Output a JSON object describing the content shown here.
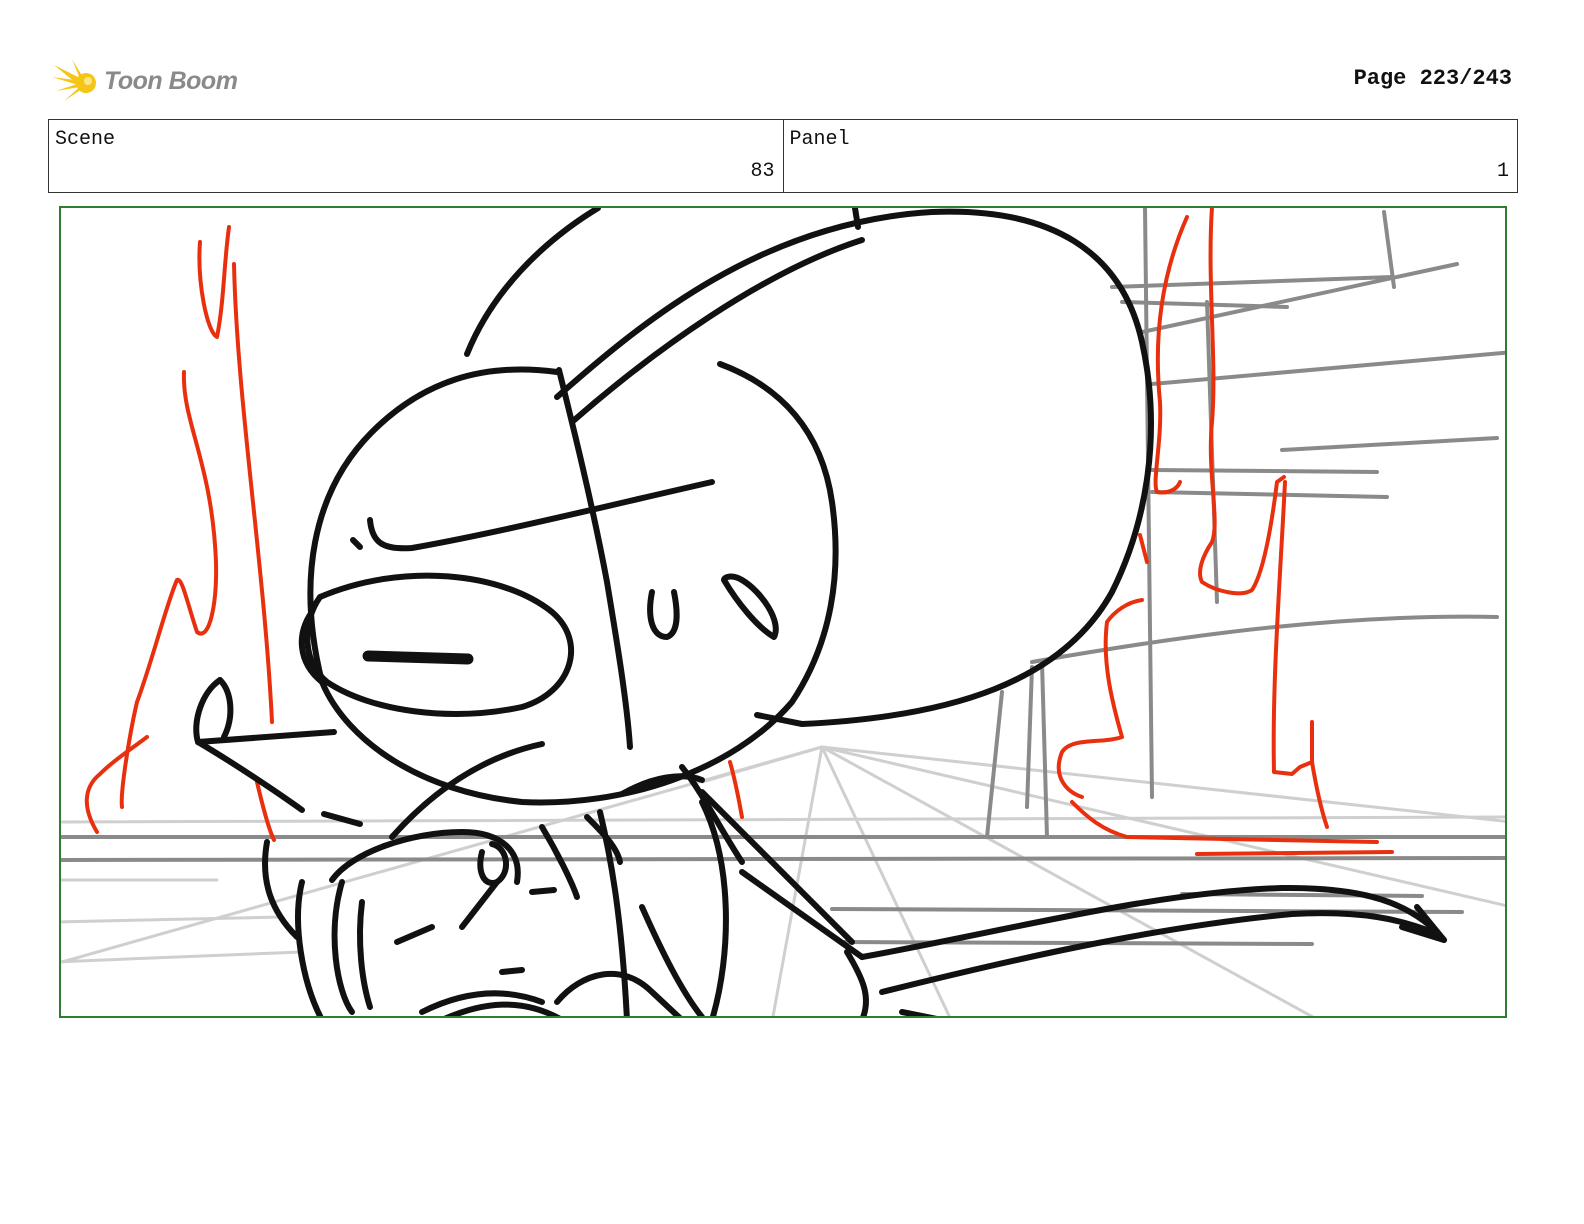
{
  "header": {
    "logo_text": "Toon Boom",
    "page_label": "Page 223/243"
  },
  "info": {
    "scene_label": "Scene",
    "scene_value": "83",
    "panel_label": "Panel",
    "panel_value": "1"
  },
  "colors": {
    "frame_border": "#2e7d32",
    "sketch_black": "#111111",
    "sketch_red": "#e8300f",
    "sketch_gray": "#8c8c8c",
    "sketch_light_gray": "#c8c8c8",
    "logo_yellow": "#f5c518"
  }
}
